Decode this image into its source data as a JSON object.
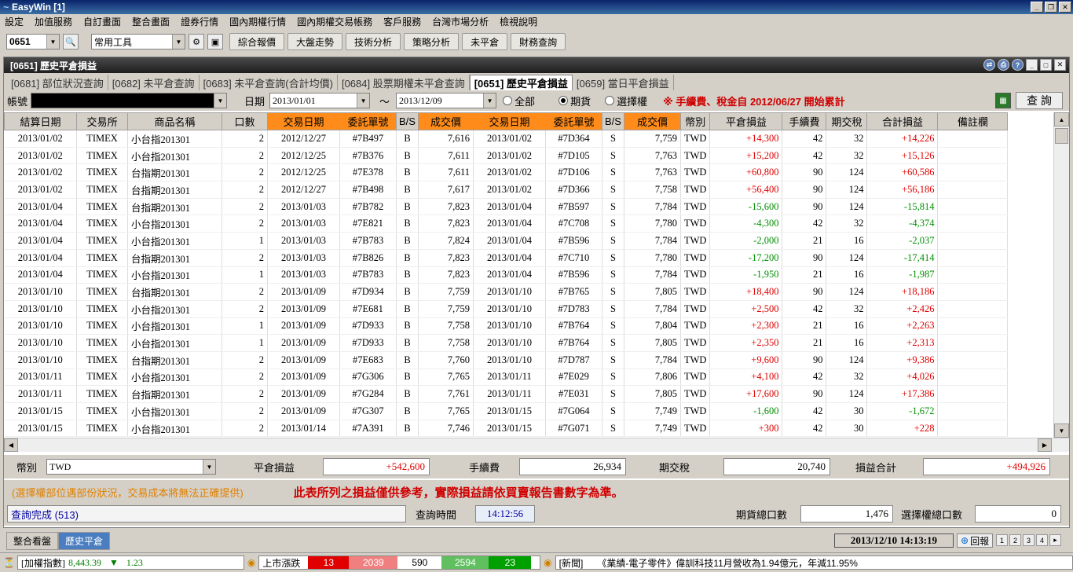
{
  "window": {
    "title": "EasyWin  [1]",
    "logo": "~"
  },
  "menu": [
    "設定",
    "加值服務",
    "自訂畫面",
    "整合畫面",
    "證券行情",
    "國內期權行情",
    "國內期權交易帳務",
    "客戶服務",
    "台灣市場分析",
    "檢視說明"
  ],
  "toolbar": {
    "code": "0651",
    "tools": "常用工具",
    "buttons": [
      "綜合報價",
      "大盤走勢",
      "技術分析",
      "策略分析",
      "未平倉",
      "財務查詢"
    ]
  },
  "panel": {
    "title": "[0651] 歷史平倉損益"
  },
  "tabs": [
    "[0681] 部位狀況查詢",
    "[0682] 未平倉查詢",
    "[0683] 未平倉查詢(合計均價)",
    "[0684] 股票期權未平倉查詢",
    "[0651] 歷史平倉損益",
    "[0659] 當日平倉損益"
  ],
  "filter": {
    "account_label": "帳號",
    "date_label": "日期",
    "date_from": "2013/01/01",
    "tilde": "～",
    "date_to": "2013/12/09",
    "radio_all": "全部",
    "radio_futures": "期貨",
    "radio_options": "選擇權",
    "note": "※  手續費、稅金自  2012/06/27  開始累計",
    "query": "查  詢"
  },
  "columns": [
    "結算日期",
    "交易所",
    "商品名稱",
    "口數",
    "交易日期",
    "委託單號",
    "B/S",
    "成交價",
    "交易日期",
    "委託單號",
    "B/S",
    "成交價",
    "幣別",
    "平倉損益",
    "手續費",
    "期交稅",
    "合計損益",
    "備註欄"
  ],
  "rows": [
    [
      "2013/01/02",
      "TIMEX",
      "小台指201301",
      "2",
      "2012/12/27",
      "#7B497",
      "B",
      "7,616",
      "2013/01/02",
      "#7D364",
      "S",
      "7,759",
      "TWD",
      "+14,300",
      "42",
      "32",
      "+14,226"
    ],
    [
      "2013/01/02",
      "TIMEX",
      "小台指201301",
      "2",
      "2012/12/25",
      "#7B376",
      "B",
      "7,611",
      "2013/01/02",
      "#7D105",
      "S",
      "7,763",
      "TWD",
      "+15,200",
      "42",
      "32",
      "+15,126"
    ],
    [
      "2013/01/02",
      "TIMEX",
      "台指期201301",
      "2",
      "2012/12/25",
      "#7E378",
      "B",
      "7,611",
      "2013/01/02",
      "#7D106",
      "S",
      "7,763",
      "TWD",
      "+60,800",
      "90",
      "124",
      "+60,586"
    ],
    [
      "2013/01/02",
      "TIMEX",
      "台指期201301",
      "2",
      "2012/12/27",
      "#7B498",
      "B",
      "7,617",
      "2013/01/02",
      "#7D366",
      "S",
      "7,758",
      "TWD",
      "+56,400",
      "90",
      "124",
      "+56,186"
    ],
    [
      "2013/01/04",
      "TIMEX",
      "台指期201301",
      "2",
      "2013/01/03",
      "#7B782",
      "B",
      "7,823",
      "2013/01/04",
      "#7B597",
      "S",
      "7,784",
      "TWD",
      "-15,600",
      "90",
      "124",
      "-15,814"
    ],
    [
      "2013/01/04",
      "TIMEX",
      "小台指201301",
      "2",
      "2013/01/03",
      "#7E821",
      "B",
      "7,823",
      "2013/01/04",
      "#7C708",
      "S",
      "7,780",
      "TWD",
      "-4,300",
      "42",
      "32",
      "-4,374"
    ],
    [
      "2013/01/04",
      "TIMEX",
      "小台指201301",
      "1",
      "2013/01/03",
      "#7B783",
      "B",
      "7,824",
      "2013/01/04",
      "#7B596",
      "S",
      "7,784",
      "TWD",
      "-2,000",
      "21",
      "16",
      "-2,037"
    ],
    [
      "2013/01/04",
      "TIMEX",
      "台指期201301",
      "2",
      "2013/01/03",
      "#7B826",
      "B",
      "7,823",
      "2013/01/04",
      "#7C710",
      "S",
      "7,780",
      "TWD",
      "-17,200",
      "90",
      "124",
      "-17,414"
    ],
    [
      "2013/01/04",
      "TIMEX",
      "小台指201301",
      "1",
      "2013/01/03",
      "#7B783",
      "B",
      "7,823",
      "2013/01/04",
      "#7B596",
      "S",
      "7,784",
      "TWD",
      "-1,950",
      "21",
      "16",
      "-1,987"
    ],
    [
      "2013/01/10",
      "TIMEX",
      "台指期201301",
      "2",
      "2013/01/09",
      "#7D934",
      "B",
      "7,759",
      "2013/01/10",
      "#7B765",
      "S",
      "7,805",
      "TWD",
      "+18,400",
      "90",
      "124",
      "+18,186"
    ],
    [
      "2013/01/10",
      "TIMEX",
      "小台指201301",
      "2",
      "2013/01/09",
      "#7E681",
      "B",
      "7,759",
      "2013/01/10",
      "#7D783",
      "S",
      "7,784",
      "TWD",
      "+2,500",
      "42",
      "32",
      "+2,426"
    ],
    [
      "2013/01/10",
      "TIMEX",
      "小台指201301",
      "1",
      "2013/01/09",
      "#7D933",
      "B",
      "7,758",
      "2013/01/10",
      "#7B764",
      "S",
      "7,804",
      "TWD",
      "+2,300",
      "21",
      "16",
      "+2,263"
    ],
    [
      "2013/01/10",
      "TIMEX",
      "小台指201301",
      "1",
      "2013/01/09",
      "#7D933",
      "B",
      "7,758",
      "2013/01/10",
      "#7B764",
      "S",
      "7,805",
      "TWD",
      "+2,350",
      "21",
      "16",
      "+2,313"
    ],
    [
      "2013/01/10",
      "TIMEX",
      "台指期201301",
      "2",
      "2013/01/09",
      "#7E683",
      "B",
      "7,760",
      "2013/01/10",
      "#7D787",
      "S",
      "7,784",
      "TWD",
      "+9,600",
      "90",
      "124",
      "+9,386"
    ],
    [
      "2013/01/11",
      "TIMEX",
      "小台指201301",
      "2",
      "2013/01/09",
      "#7G306",
      "B",
      "7,765",
      "2013/01/11",
      "#7E029",
      "S",
      "7,806",
      "TWD",
      "+4,100",
      "42",
      "32",
      "+4,026"
    ],
    [
      "2013/01/11",
      "TIMEX",
      "台指期201301",
      "2",
      "2013/01/09",
      "#7G284",
      "B",
      "7,761",
      "2013/01/11",
      "#7E031",
      "S",
      "7,805",
      "TWD",
      "+17,600",
      "90",
      "124",
      "+17,386"
    ],
    [
      "2013/01/15",
      "TIMEX",
      "小台指201301",
      "2",
      "2013/01/09",
      "#7G307",
      "B",
      "7,765",
      "2013/01/15",
      "#7G064",
      "S",
      "7,749",
      "TWD",
      "-1,600",
      "42",
      "30",
      "-1,672"
    ],
    [
      "2013/01/15",
      "TIMEX",
      "小台指201301",
      "2",
      "2013/01/14",
      "#7A391",
      "B",
      "7,746",
      "2013/01/15",
      "#7G071",
      "S",
      "7,749",
      "TWD",
      "+300",
      "42",
      "30",
      "+228"
    ]
  ],
  "summary": {
    "currency_label": "幣別",
    "currency": "TWD",
    "pnl_label": "平倉損益",
    "pnl": "+542,600",
    "fee_label": "手續費",
    "fee": "26,934",
    "tax_label": "期交稅",
    "tax": "20,740",
    "total_label": "損益合計",
    "total": "+494,926"
  },
  "warning": {
    "left": "(選擇權部位遇部份狀況，交易成本將無法正確提供)",
    "center": "此表所列之損益僅供參考，實際損益請依買賣報告書數字為準。"
  },
  "status": {
    "text": "查詢完成 (513)",
    "time_label": "查詢時間",
    "time": "14:12:56",
    "fut_label": "期貨總口數",
    "fut": "1,476",
    "opt_label": "選擇權總口數",
    "opt": "0"
  },
  "bottom": {
    "tabs": [
      "整合看盤",
      "歷史平倉"
    ],
    "datetime": "2013/12/10 14:13:19",
    "back": "回報"
  },
  "ticker": {
    "index_label": "[加權指數]",
    "index": "8,443.39",
    "change_arrow": "▼",
    "change": "1.23",
    "market_label": "上市漲跌",
    "b1": "13",
    "b2": "2039",
    "b3": "590",
    "b4": "2594",
    "b5": "23",
    "news_label": "[新聞]",
    "news": "《業績-電子零件》偉訓科技11月營收為1.94億元，年減11.95%"
  },
  "colors": {
    "orange_header": "#ff8c1a",
    "positive": "#e00000",
    "negative": "#009000",
    "warn": "#d00000"
  }
}
